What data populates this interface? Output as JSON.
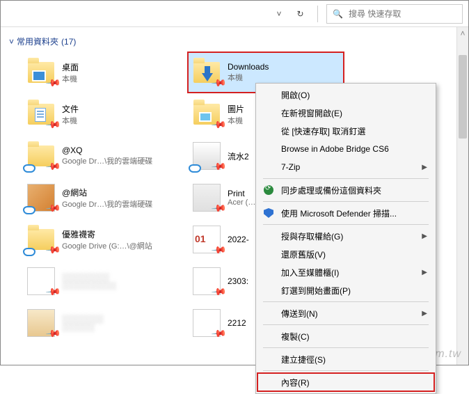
{
  "search": {
    "placeholder": "搜尋 快速存取"
  },
  "group": {
    "title": "常用資料夾",
    "count": "(17)"
  },
  "items": [
    {
      "title": "桌面",
      "sub": "本機",
      "icon": "folder",
      "overlay": "desktop"
    },
    {
      "title": "Downloads",
      "sub": "本機",
      "icon": "folder",
      "overlay": "download",
      "selected": true,
      "marked": true
    },
    {
      "title": "文件",
      "sub": "本機",
      "icon": "folder",
      "overlay": "doc"
    },
    {
      "title": "圖片",
      "sub": "本機",
      "icon": "folder",
      "overlay": "pic"
    },
    {
      "title": "@XQ",
      "sub": "Google Dr…\\我的雲端硬碟",
      "icon": "folder",
      "cloud": true
    },
    {
      "title": "流水2",
      "sub": "",
      "icon": "thumb",
      "thumbClass": "p2",
      "cloud": true
    },
    {
      "title": "@網站",
      "sub": "Google Dr…\\我的雲端硬碟",
      "icon": "thumb",
      "thumbClass": "p1",
      "cloud": true
    },
    {
      "title": "Print",
      "sub": "Acer (…",
      "icon": "thumb",
      "thumbClass": "p3"
    },
    {
      "title": "優雅襪寄",
      "sub": "Google Drive (G:…\\@網站",
      "icon": "folder",
      "cloud": true
    },
    {
      "title": "2022-",
      "sub": "",
      "icon": "thumb",
      "thumbClass": "p4"
    },
    {
      "title": "░░░░░░░░",
      "sub": "░░░░░░░░░░",
      "icon": "thumb",
      "thumbClass": "p5",
      "blurred": true
    },
    {
      "title": "2303:",
      "sub": "",
      "icon": "thumb",
      "thumbClass": "p5"
    },
    {
      "title": "░░░░░░░",
      "sub": "░░░░░░",
      "icon": "thumb",
      "thumbClass": "p6",
      "blurred": true
    },
    {
      "title": "2212",
      "sub": "",
      "icon": "thumb",
      "thumbClass": "p5"
    }
  ],
  "contextMenu": [
    {
      "label": "開啟(O)",
      "type": "item"
    },
    {
      "label": "在新視窗開啟(E)",
      "type": "item"
    },
    {
      "label": "從 [快速存取] 取消釘選",
      "type": "item"
    },
    {
      "label": "Browse in Adobe Bridge CS6",
      "type": "item"
    },
    {
      "label": "7-Zip",
      "type": "item",
      "submenu": true
    },
    {
      "type": "sep"
    },
    {
      "label": "同步處理或備份這個資料夾",
      "type": "item",
      "icon": "sync"
    },
    {
      "type": "sep"
    },
    {
      "label": "使用 Microsoft Defender 掃描...",
      "type": "item",
      "icon": "shield"
    },
    {
      "type": "sep"
    },
    {
      "label": "授與存取權給(G)",
      "type": "item",
      "submenu": true
    },
    {
      "label": "還原舊版(V)",
      "type": "item"
    },
    {
      "label": "加入至媒體櫃(I)",
      "type": "item",
      "submenu": true
    },
    {
      "label": "釘選到開始畫面(P)",
      "type": "item"
    },
    {
      "type": "sep"
    },
    {
      "label": "傳送到(N)",
      "type": "item",
      "submenu": true
    },
    {
      "type": "sep"
    },
    {
      "label": "複製(C)",
      "type": "item"
    },
    {
      "type": "sep"
    },
    {
      "label": "建立捷徑(S)",
      "type": "item"
    },
    {
      "type": "sep"
    },
    {
      "label": "內容(R)",
      "type": "item",
      "highlight": true
    }
  ],
  "watermark": "smallway.com.tw"
}
